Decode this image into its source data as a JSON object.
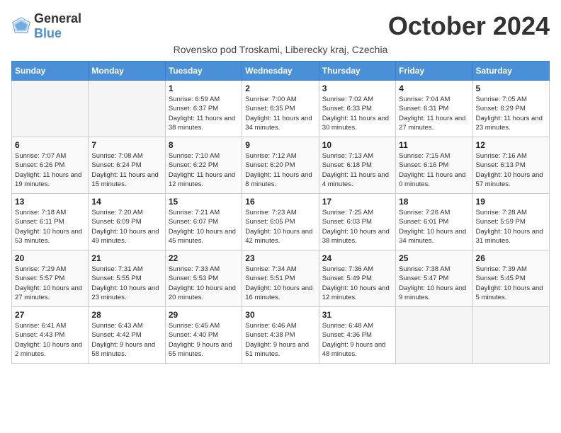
{
  "header": {
    "logo_general": "General",
    "logo_blue": "Blue",
    "month_title": "October 2024",
    "location": "Rovensko pod Troskami, Liberecky kraj, Czechia"
  },
  "weekdays": [
    "Sunday",
    "Monday",
    "Tuesday",
    "Wednesday",
    "Thursday",
    "Friday",
    "Saturday"
  ],
  "weeks": [
    [
      {
        "day": "",
        "info": ""
      },
      {
        "day": "",
        "info": ""
      },
      {
        "day": "1",
        "info": "Sunrise: 6:59 AM\nSunset: 6:37 PM\nDaylight: 11 hours and 38 minutes."
      },
      {
        "day": "2",
        "info": "Sunrise: 7:00 AM\nSunset: 6:35 PM\nDaylight: 11 hours and 34 minutes."
      },
      {
        "day": "3",
        "info": "Sunrise: 7:02 AM\nSunset: 6:33 PM\nDaylight: 11 hours and 30 minutes."
      },
      {
        "day": "4",
        "info": "Sunrise: 7:04 AM\nSunset: 6:31 PM\nDaylight: 11 hours and 27 minutes."
      },
      {
        "day": "5",
        "info": "Sunrise: 7:05 AM\nSunset: 6:29 PM\nDaylight: 11 hours and 23 minutes."
      }
    ],
    [
      {
        "day": "6",
        "info": "Sunrise: 7:07 AM\nSunset: 6:26 PM\nDaylight: 11 hours and 19 minutes."
      },
      {
        "day": "7",
        "info": "Sunrise: 7:08 AM\nSunset: 6:24 PM\nDaylight: 11 hours and 15 minutes."
      },
      {
        "day": "8",
        "info": "Sunrise: 7:10 AM\nSunset: 6:22 PM\nDaylight: 11 hours and 12 minutes."
      },
      {
        "day": "9",
        "info": "Sunrise: 7:12 AM\nSunset: 6:20 PM\nDaylight: 11 hours and 8 minutes."
      },
      {
        "day": "10",
        "info": "Sunrise: 7:13 AM\nSunset: 6:18 PM\nDaylight: 11 hours and 4 minutes."
      },
      {
        "day": "11",
        "info": "Sunrise: 7:15 AM\nSunset: 6:16 PM\nDaylight: 11 hours and 0 minutes."
      },
      {
        "day": "12",
        "info": "Sunrise: 7:16 AM\nSunset: 6:13 PM\nDaylight: 10 hours and 57 minutes."
      }
    ],
    [
      {
        "day": "13",
        "info": "Sunrise: 7:18 AM\nSunset: 6:11 PM\nDaylight: 10 hours and 53 minutes."
      },
      {
        "day": "14",
        "info": "Sunrise: 7:20 AM\nSunset: 6:09 PM\nDaylight: 10 hours and 49 minutes."
      },
      {
        "day": "15",
        "info": "Sunrise: 7:21 AM\nSunset: 6:07 PM\nDaylight: 10 hours and 45 minutes."
      },
      {
        "day": "16",
        "info": "Sunrise: 7:23 AM\nSunset: 6:05 PM\nDaylight: 10 hours and 42 minutes."
      },
      {
        "day": "17",
        "info": "Sunrise: 7:25 AM\nSunset: 6:03 PM\nDaylight: 10 hours and 38 minutes."
      },
      {
        "day": "18",
        "info": "Sunrise: 7:26 AM\nSunset: 6:01 PM\nDaylight: 10 hours and 34 minutes."
      },
      {
        "day": "19",
        "info": "Sunrise: 7:28 AM\nSunset: 5:59 PM\nDaylight: 10 hours and 31 minutes."
      }
    ],
    [
      {
        "day": "20",
        "info": "Sunrise: 7:29 AM\nSunset: 5:57 PM\nDaylight: 10 hours and 27 minutes."
      },
      {
        "day": "21",
        "info": "Sunrise: 7:31 AM\nSunset: 5:55 PM\nDaylight: 10 hours and 23 minutes."
      },
      {
        "day": "22",
        "info": "Sunrise: 7:33 AM\nSunset: 5:53 PM\nDaylight: 10 hours and 20 minutes."
      },
      {
        "day": "23",
        "info": "Sunrise: 7:34 AM\nSunset: 5:51 PM\nDaylight: 10 hours and 16 minutes."
      },
      {
        "day": "24",
        "info": "Sunrise: 7:36 AM\nSunset: 5:49 PM\nDaylight: 10 hours and 12 minutes."
      },
      {
        "day": "25",
        "info": "Sunrise: 7:38 AM\nSunset: 5:47 PM\nDaylight: 10 hours and 9 minutes."
      },
      {
        "day": "26",
        "info": "Sunrise: 7:39 AM\nSunset: 5:45 PM\nDaylight: 10 hours and 5 minutes."
      }
    ],
    [
      {
        "day": "27",
        "info": "Sunrise: 6:41 AM\nSunset: 4:43 PM\nDaylight: 10 hours and 2 minutes."
      },
      {
        "day": "28",
        "info": "Sunrise: 6:43 AM\nSunset: 4:42 PM\nDaylight: 9 hours and 58 minutes."
      },
      {
        "day": "29",
        "info": "Sunrise: 6:45 AM\nSunset: 4:40 PM\nDaylight: 9 hours and 55 minutes."
      },
      {
        "day": "30",
        "info": "Sunrise: 6:46 AM\nSunset: 4:38 PM\nDaylight: 9 hours and 51 minutes."
      },
      {
        "day": "31",
        "info": "Sunrise: 6:48 AM\nSunset: 4:36 PM\nDaylight: 9 hours and 48 minutes."
      },
      {
        "day": "",
        "info": ""
      },
      {
        "day": "",
        "info": ""
      }
    ]
  ]
}
